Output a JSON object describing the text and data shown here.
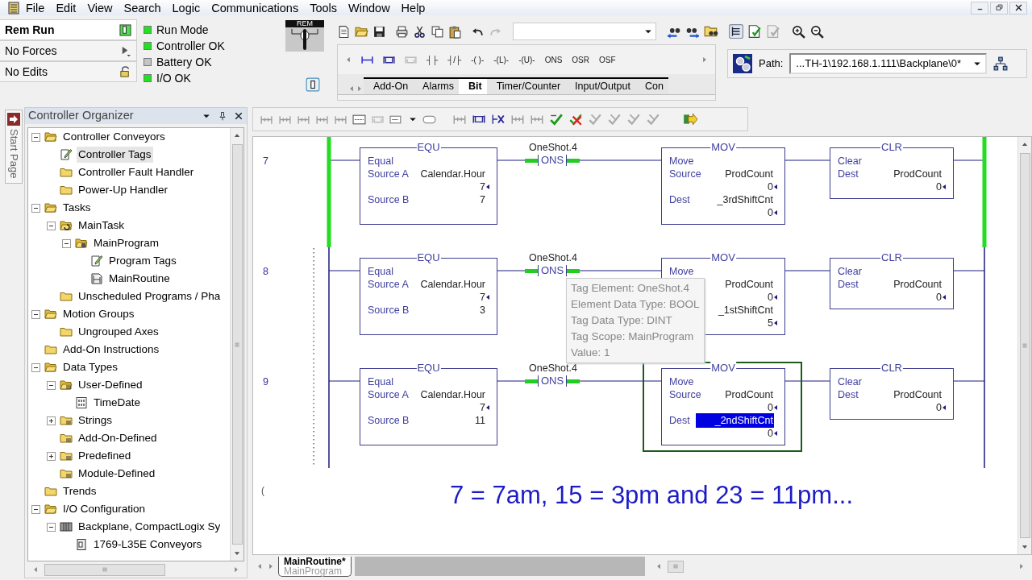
{
  "menu": [
    "File",
    "Edit",
    "View",
    "Search",
    "Logic",
    "Communications",
    "Tools",
    "Window",
    "Help"
  ],
  "status": [
    {
      "label": "Rem Run",
      "kind": "mode"
    },
    {
      "label": "No Forces",
      "kind": "forces"
    },
    {
      "label": "No Edits",
      "kind": "edits"
    }
  ],
  "leds": [
    {
      "label": "Run Mode",
      "on": true
    },
    {
      "label": "Controller OK",
      "on": true
    },
    {
      "label": "Battery OK",
      "on": false
    },
    {
      "label": "I/O OK",
      "on": true
    }
  ],
  "key_switch": {
    "label": "REM"
  },
  "instruction_buttons": [
    "┤├",
    "┤/├",
    "-( )-",
    "-(L)-",
    "-(U)-",
    "ONS",
    "OSR",
    "OSF"
  ],
  "instruction_tabs": [
    {
      "label": "Add-On",
      "selected": false
    },
    {
      "label": "Alarms",
      "selected": false
    },
    {
      "label": "Bit",
      "selected": true
    },
    {
      "label": "Timer/Counter",
      "selected": false
    },
    {
      "label": "Input/Output",
      "selected": false
    },
    {
      "label": "Con",
      "selected": false
    }
  ],
  "path": {
    "label": "Path:",
    "value": "...TH-1\\192.168.1.111\\Backplane\\0*"
  },
  "start_tab": "Start Page",
  "organizer": {
    "title": "Controller Organizer",
    "tree": [
      {
        "label": "Controller Conveyors",
        "kind": "folder",
        "expanded": true,
        "selected": false,
        "children": [
          {
            "label": "Controller Tags",
            "kind": "tags",
            "selected": true
          },
          {
            "label": "Controller Fault Handler",
            "kind": "folder",
            "selected": false
          },
          {
            "label": "Power-Up Handler",
            "kind": "folder",
            "selected": false
          }
        ]
      },
      {
        "label": "Tasks",
        "kind": "folder",
        "expanded": true,
        "selected": false,
        "children": [
          {
            "label": "MainTask",
            "kind": "task",
            "expanded": true,
            "selected": false,
            "children": [
              {
                "label": "MainProgram",
                "kind": "program",
                "expanded": true,
                "selected": false,
                "children": [
                  {
                    "label": "Program Tags",
                    "kind": "tags",
                    "selected": false
                  },
                  {
                    "label": "MainRoutine",
                    "kind": "routine",
                    "selected": false
                  }
                ]
              }
            ]
          },
          {
            "label": "Unscheduled Programs / Pha",
            "kind": "folder",
            "selected": false
          }
        ]
      },
      {
        "label": "Motion Groups",
        "kind": "folder",
        "expanded": true,
        "selected": false,
        "children": [
          {
            "label": "Ungrouped Axes",
            "kind": "folder",
            "selected": false
          }
        ]
      },
      {
        "label": "Add-On Instructions",
        "kind": "folder",
        "selected": false
      },
      {
        "label": "Data Types",
        "kind": "folder",
        "expanded": true,
        "selected": false,
        "children": [
          {
            "label": "User-Defined",
            "kind": "datatypes",
            "expanded": true,
            "selected": false,
            "children": [
              {
                "label": "TimeDate",
                "kind": "datatype",
                "selected": false
              }
            ]
          },
          {
            "label": "Strings",
            "kind": "datatypes",
            "expanded": false,
            "selected": false
          },
          {
            "label": "Add-On-Defined",
            "kind": "datatypes",
            "selected": false
          },
          {
            "label": "Predefined",
            "kind": "datatypes",
            "expanded": false,
            "selected": false
          },
          {
            "label": "Module-Defined",
            "kind": "datatypes",
            "selected": false
          }
        ]
      },
      {
        "label": "Trends",
        "kind": "folder",
        "selected": false
      },
      {
        "label": "I/O Configuration",
        "kind": "folder",
        "expanded": true,
        "selected": false,
        "children": [
          {
            "label": "Backplane, CompactLogix Sy",
            "kind": "backplane",
            "expanded": true,
            "selected": false,
            "children": [
              {
                "label": "1769-L35E Conveyors",
                "kind": "module",
                "selected": false
              }
            ]
          }
        ]
      }
    ]
  },
  "rungs": [
    {
      "number": "7",
      "energized": true,
      "instructions": [
        {
          "kind": "equ",
          "title": "EQU",
          "selected": false,
          "lines": [
            {
              "label": "Equal"
            },
            {
              "label": "Source A",
              "value": "Calendar.Hour"
            },
            {
              "value": "7",
              "arrow": true
            },
            {
              "label": "Source B",
              "value": "7"
            }
          ]
        },
        {
          "kind": "ons",
          "title": "ONS",
          "tag": "OneShot.4",
          "on": true,
          "selected": false
        },
        {
          "kind": "mov",
          "title": "MOV",
          "selected": false,
          "lines": [
            {
              "label": "Move"
            },
            {
              "label": "Source",
              "value": "ProdCount"
            },
            {
              "value": "0",
              "arrow": true
            },
            {
              "label": "Dest",
              "value": "_3rdShiftCnt"
            },
            {
              "value": "0",
              "arrow": true
            }
          ]
        },
        {
          "kind": "clr",
          "title": "CLR",
          "selected": false,
          "lines": [
            {
              "label": "Clear"
            },
            {
              "label": "Dest",
              "value": "ProdCount"
            },
            {
              "value": "0",
              "arrow": true
            }
          ]
        }
      ]
    },
    {
      "number": "8",
      "energized": false,
      "instructions": [
        {
          "kind": "equ",
          "title": "EQU",
          "selected": false,
          "lines": [
            {
              "label": "Equal"
            },
            {
              "label": "Source A",
              "value": "Calendar.Hour"
            },
            {
              "value": "7",
              "arrow": true
            },
            {
              "label": "Source B",
              "value": "3"
            }
          ]
        },
        {
          "kind": "ons",
          "title": "ONS",
          "tag": "OneShot.4",
          "on": true,
          "selected": false
        },
        {
          "kind": "mov",
          "title": "MOV",
          "selected": false,
          "lines": [
            {
              "label": "Move"
            },
            {
              "value": "ProdCount"
            },
            {
              "value": "0",
              "arrow": true
            },
            {
              "value": "_1stShiftCnt"
            },
            {
              "value": "5",
              "arrow": true
            }
          ]
        },
        {
          "kind": "clr",
          "title": "CLR",
          "selected": false,
          "lines": [
            {
              "label": "Clear"
            },
            {
              "label": "Dest",
              "value": "ProdCount"
            },
            {
              "value": "0",
              "arrow": true
            }
          ]
        }
      ]
    },
    {
      "number": "9",
      "energized": false,
      "instructions": [
        {
          "kind": "equ",
          "title": "EQU",
          "selected": false,
          "lines": [
            {
              "label": "Equal"
            },
            {
              "label": "Source A",
              "value": "Calendar.Hour"
            },
            {
              "value": "7",
              "arrow": true
            },
            {
              "label": "Source B",
              "value": "11"
            }
          ]
        },
        {
          "kind": "ons",
          "title": "ONS",
          "tag": "OneShot.4",
          "on": true,
          "selected": false
        },
        {
          "kind": "mov",
          "title": "MOV",
          "selected": true,
          "lines": [
            {
              "label": "Move"
            },
            {
              "label": "Source",
              "value": "ProdCount"
            },
            {
              "value": "0",
              "arrow": true
            },
            {
              "label": "Dest",
              "value": "_2ndShiftCnt",
              "selected": true
            },
            {
              "value": "0",
              "arrow": true
            }
          ]
        },
        {
          "kind": "clr",
          "title": "CLR",
          "selected": false,
          "lines": [
            {
              "label": "Clear"
            },
            {
              "label": "Dest",
              "value": "ProdCount"
            },
            {
              "value": "0",
              "arrow": true
            }
          ]
        }
      ]
    }
  ],
  "tooltip": [
    "Tag Element: OneShot.4",
    "Element Data Type: BOOL",
    "Tag Data Type: DINT",
    "Tag Scope: MainProgram",
    "Value: 1"
  ],
  "end_mark": "(",
  "caption": "7 = 7am, 15 = 3pm and 23 = 11pm...",
  "routine_tabs": [
    {
      "title": "MainRoutine*",
      "subtitle": "MainProgram",
      "selected": true
    }
  ]
}
